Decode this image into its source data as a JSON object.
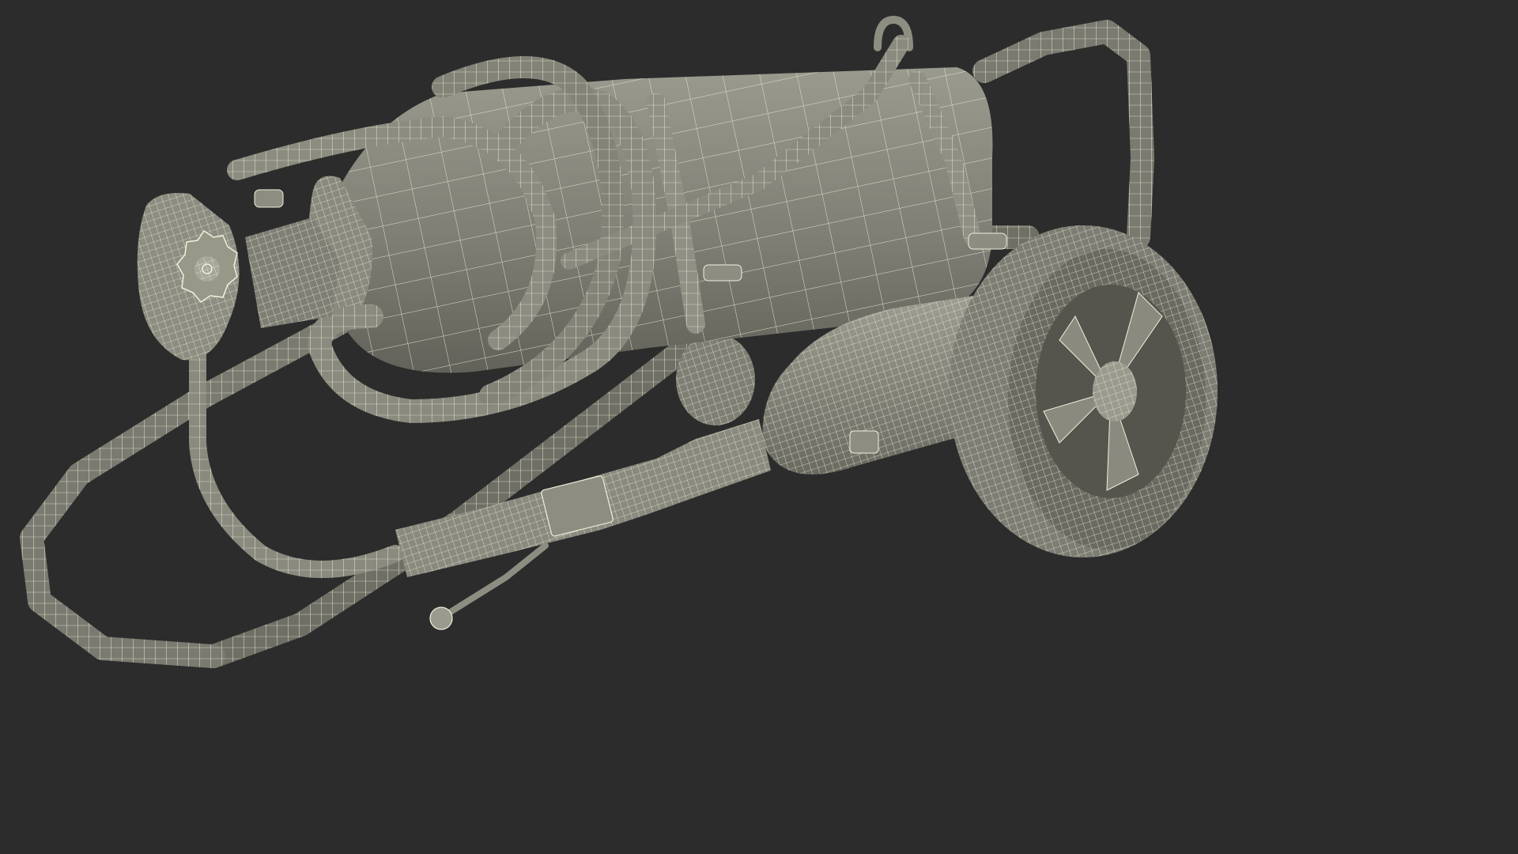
{
  "scene": {
    "subject": "wheeled-cylinder-cart-wireframe",
    "parts": [
      "gas-cylinder",
      "cart-handle-frame",
      "coiled-hose",
      "valve-handwheel",
      "regulator-canister",
      "spray-nozzle",
      "wheel-rear",
      "wheel-front"
    ]
  },
  "colors": {
    "background": "#2c2c2c",
    "body": "#85857a",
    "body_dark": "#6b6b61",
    "body_light": "#a3a396",
    "wire": "#f2f0dc",
    "shadow": "#4c4c45"
  }
}
